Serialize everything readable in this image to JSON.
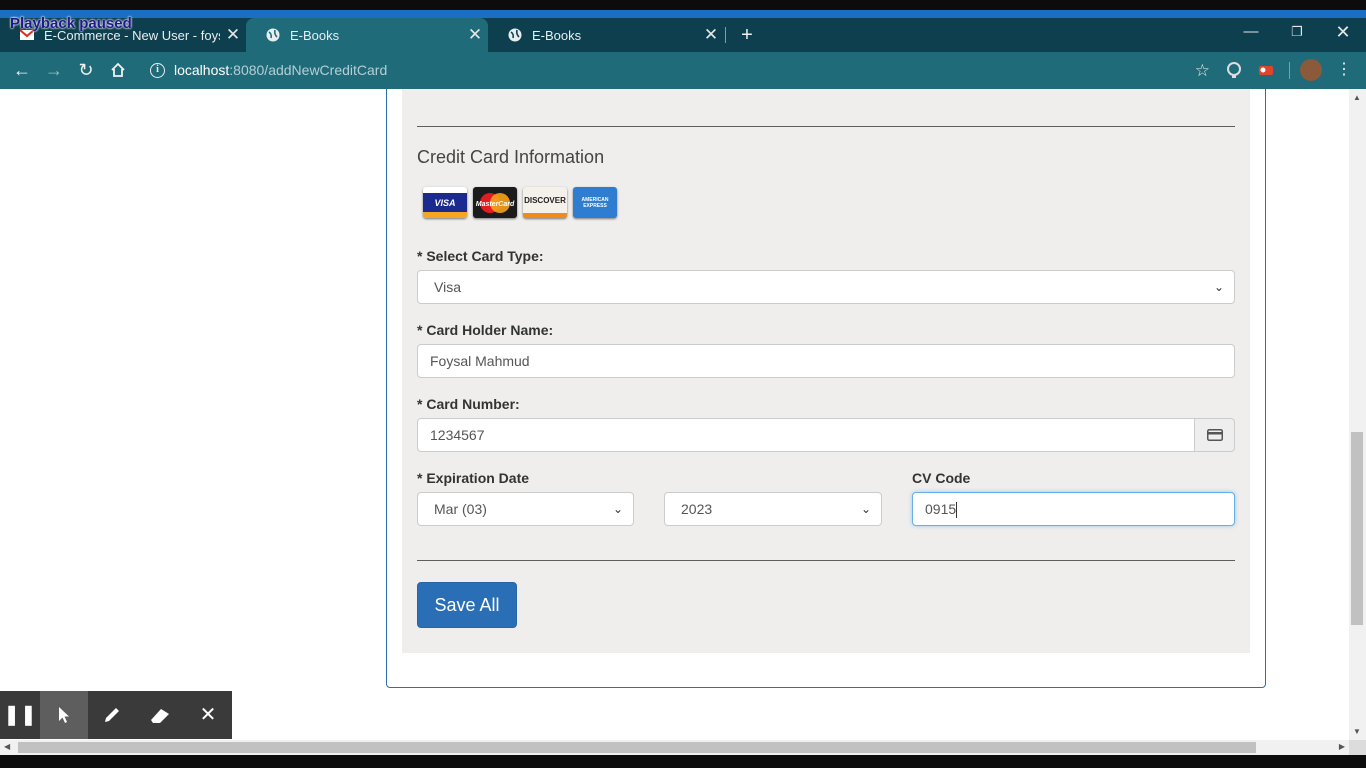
{
  "browser": {
    "tabs": [
      {
        "title": "E-Commerce - New User - foysal",
        "active": false
      },
      {
        "title": "E-Books",
        "active": true
      },
      {
        "title": "E-Books",
        "active": false
      }
    ],
    "url_host": "localhost",
    "url_path": ":8080/addNewCreditCard"
  },
  "overlay": {
    "status": "Playback paused"
  },
  "form": {
    "section_title": "Credit Card Information",
    "card_logos": [
      "VISA",
      "MasterCard",
      "DISCOVER",
      "AMERICAN EXPRESS"
    ],
    "card_type_label": "* Select Card Type:",
    "card_type_value": "Visa",
    "holder_label": "* Card Holder Name:",
    "holder_value": "Foysal Mahmud",
    "number_label": "* Card Number:",
    "number_value": "1234567",
    "expiration_label": "* Expiration Date",
    "exp_month_value": "Mar (03)",
    "exp_year_value": "2023",
    "cv_label": "CV Code",
    "cv_value": "0915",
    "save_label": "Save All"
  },
  "colors": {
    "primary_button": "#2a6fb5",
    "tab_bar": "#0d3f4e",
    "toolbar": "#1f6b79"
  }
}
